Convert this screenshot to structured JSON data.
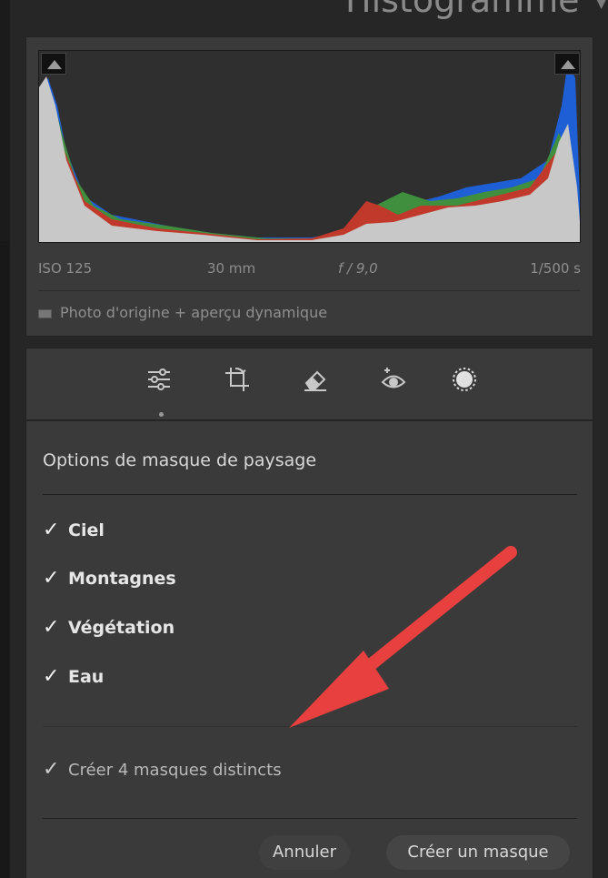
{
  "header": {
    "title": "Histogramme",
    "collapse_glyph": "▼"
  },
  "histogram": {
    "iso": "ISO 125",
    "focal_length": "30 mm",
    "aperture": "f / 9,0",
    "shutter": "1/500 s",
    "preview_label": "Photo d'origine + aperçu dynamique",
    "colors": {
      "red": "#c0392b",
      "green": "#3f8f3f",
      "blue": "#1f5fd6",
      "gray": "#c8c8c8"
    }
  },
  "tools": [
    {
      "name": "edit-sliders-icon"
    },
    {
      "name": "crop-icon"
    },
    {
      "name": "healing-eraser-icon"
    },
    {
      "name": "red-eye-icon"
    },
    {
      "name": "masking-icon"
    }
  ],
  "options": {
    "title": "Options de masque de paysage",
    "items": [
      {
        "label": "Ciel",
        "checked": true
      },
      {
        "label": "Montagnes",
        "checked": true
      },
      {
        "label": "Végétation",
        "checked": true
      },
      {
        "label": "Eau",
        "checked": true
      }
    ],
    "distinct": {
      "label": "Créer 4 masques distincts",
      "checked": true
    },
    "cancel_label": "Annuler",
    "create_label": "Créer un masque",
    "check_glyph": "✓"
  },
  "annotation": {
    "arrow_color": "#e8403f"
  }
}
